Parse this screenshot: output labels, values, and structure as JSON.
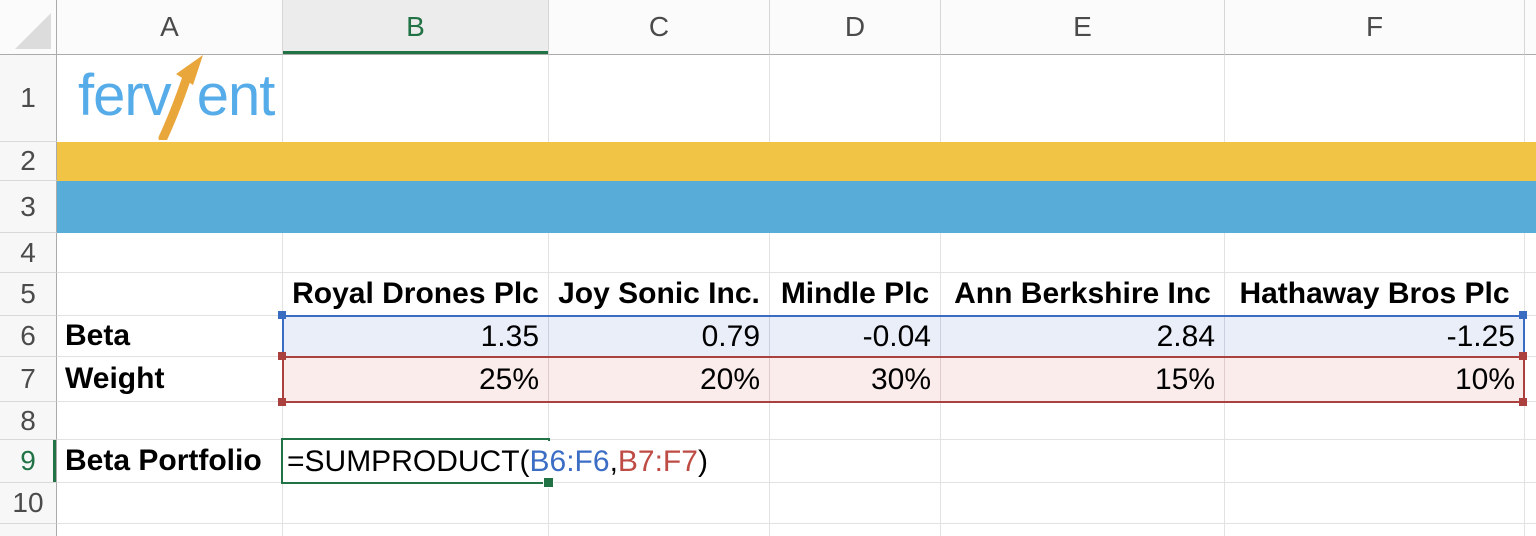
{
  "logo": {
    "part1": "ferv",
    "part2": "ent",
    "blue": "#55ACE9",
    "orange": "#E9A63B"
  },
  "grid": {
    "column_headers": [
      "A",
      "B",
      "C",
      "D",
      "E",
      "F"
    ],
    "active_column": "B",
    "row_headers": [
      "1",
      "2",
      "3",
      "4",
      "5",
      "6",
      "7",
      "8",
      "9",
      "10"
    ],
    "active_row": "9"
  },
  "bands": {
    "yellow": "#F2C445",
    "blue": "#58ACD8"
  },
  "table": {
    "companies": [
      "Royal Drones Plc",
      "Joy Sonic Inc.",
      "Mindle Plc",
      "Ann Berkshire Inc",
      "Hathaway Bros Plc"
    ],
    "rows": [
      {
        "label": "Beta",
        "values": [
          "1.35",
          "0.79",
          "-0.04",
          "2.84",
          "-1.25"
        ]
      },
      {
        "label": "Weight",
        "values": [
          "25%",
          "20%",
          "30%",
          "15%",
          "10%"
        ]
      }
    ],
    "result_label": "Beta Portfolio"
  },
  "formula": {
    "prefix": "=SUMPRODUCT(",
    "arg1": "B6:F6",
    "comma": ",",
    "arg2": "B7:F7",
    "suffix": ")",
    "arg1_color": "#3B6DC5",
    "arg2_color": "#BE4B44"
  },
  "selection": {
    "beta_range_border": "#3A6CC2",
    "beta_range_fill": "#E9EEF9",
    "weight_range_border": "#AA413E",
    "weight_range_fill": "#F9ECEB",
    "active_cell_border": "#217346",
    "active_cell": "B9"
  }
}
